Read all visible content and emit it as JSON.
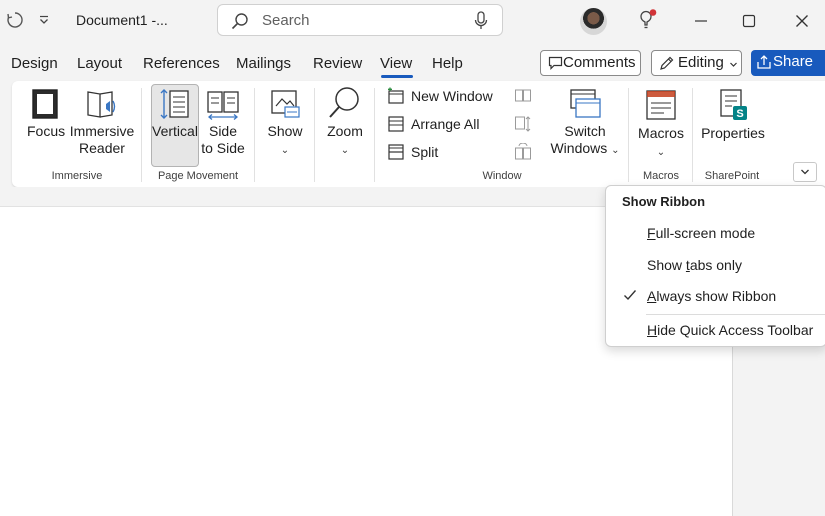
{
  "titlebar": {
    "document_title": "Document1  -...",
    "search_placeholder": "Search"
  },
  "tabs": [
    {
      "label": "Design"
    },
    {
      "label": "Layout"
    },
    {
      "label": "References"
    },
    {
      "label": "Mailings"
    },
    {
      "label": "Review"
    },
    {
      "label": "View"
    },
    {
      "label": "Help"
    }
  ],
  "active_tab": "View",
  "actions": {
    "comments": "Comments",
    "editing": "Editing",
    "share": "Share"
  },
  "ribbon": {
    "focus": "Focus",
    "immersive_reader_1": "Immersive",
    "immersive_reader_2": "Reader",
    "group_immersive": "Immersive",
    "vertical": "Vertical",
    "side_1": "Side",
    "side_2": "to Side",
    "group_page_movement": "Page Movement",
    "show": "Show",
    "zoom": "Zoom",
    "new_window": "New Window",
    "arrange_all": "Arrange All",
    "split": "Split",
    "switch_1": "Switch",
    "switch_2": "Windows",
    "group_window": "Window",
    "macros": "Macros",
    "group_macros": "Macros",
    "properties": "Properties",
    "group_sharepoint": "SharePoint"
  },
  "menu": {
    "title": "Show Ribbon",
    "items": [
      {
        "accel": "F",
        "rest": "ull-screen mode"
      },
      {
        "pre": "Show ",
        "accel": "t",
        "rest": "abs only"
      },
      {
        "accel": "A",
        "rest": "lways show Ribbon",
        "checked": true
      },
      {
        "accel": "H",
        "rest": "ide Quick Access Toolbar"
      }
    ]
  },
  "colors": {
    "accent": "#185abd",
    "notification_dot": "#d13438",
    "sharepoint_green": "#038387"
  }
}
